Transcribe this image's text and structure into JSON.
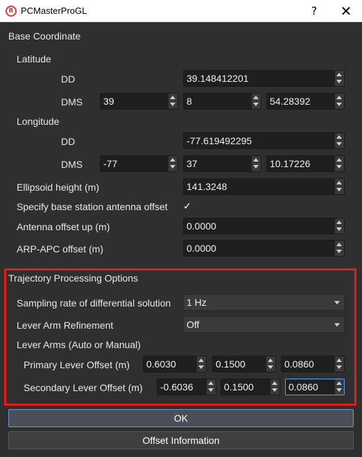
{
  "window": {
    "title": "PCMasterProGL",
    "help_glyph": "?",
    "close_glyph": "✕",
    "icon_glyph": "R"
  },
  "base_coordinate": {
    "title": "Base Coordinate",
    "latitude": {
      "label": "Latitude",
      "dd_label": "DD",
      "dd_value": "39.148412201",
      "dms_label": "DMS",
      "dms_deg": "39",
      "dms_min": "8",
      "dms_sec": "54.28392"
    },
    "longitude": {
      "label": "Longitude",
      "dd_label": "DD",
      "dd_value": "-77.619492295",
      "dms_label": "DMS",
      "dms_deg": "-77",
      "dms_min": "37",
      "dms_sec": "10.17226"
    },
    "ellipsoid_height": {
      "label": "Ellipsoid height (m)",
      "value": "141.3248"
    },
    "specify_offset": {
      "label": "Specify base station antenna offset",
      "checked_glyph": "✓"
    },
    "antenna_offset_up": {
      "label": "Antenna offset up (m)",
      "value": "0.0000"
    },
    "arp_apc_offset": {
      "label": "ARP-APC offset (m)",
      "value": "0.0000"
    }
  },
  "trajectory": {
    "title": "Trajectory Processing Options",
    "sampling_rate": {
      "label": "Sampling rate of differential solution",
      "value": "1 Hz"
    },
    "lever_arm_refinement": {
      "label": "Lever Arm Refinement",
      "value": "Off"
    },
    "lever_arms_label": "Lever Arms (Auto or Manual)",
    "primary": {
      "label": "Primary Lever Offset (m)",
      "x": "0.6030",
      "y": "0.1500",
      "z": "0.0860"
    },
    "secondary": {
      "label": "Secondary Lever Offset (m)",
      "x": "-0.6036",
      "y": "0.1500",
      "z": "0.0860"
    }
  },
  "buttons": {
    "ok": "OK",
    "offset_information": "Offset Information"
  },
  "colors": {
    "highlight": "#e41c1c",
    "background": "#2f2f2f",
    "focus": "#5fa3e8"
  }
}
